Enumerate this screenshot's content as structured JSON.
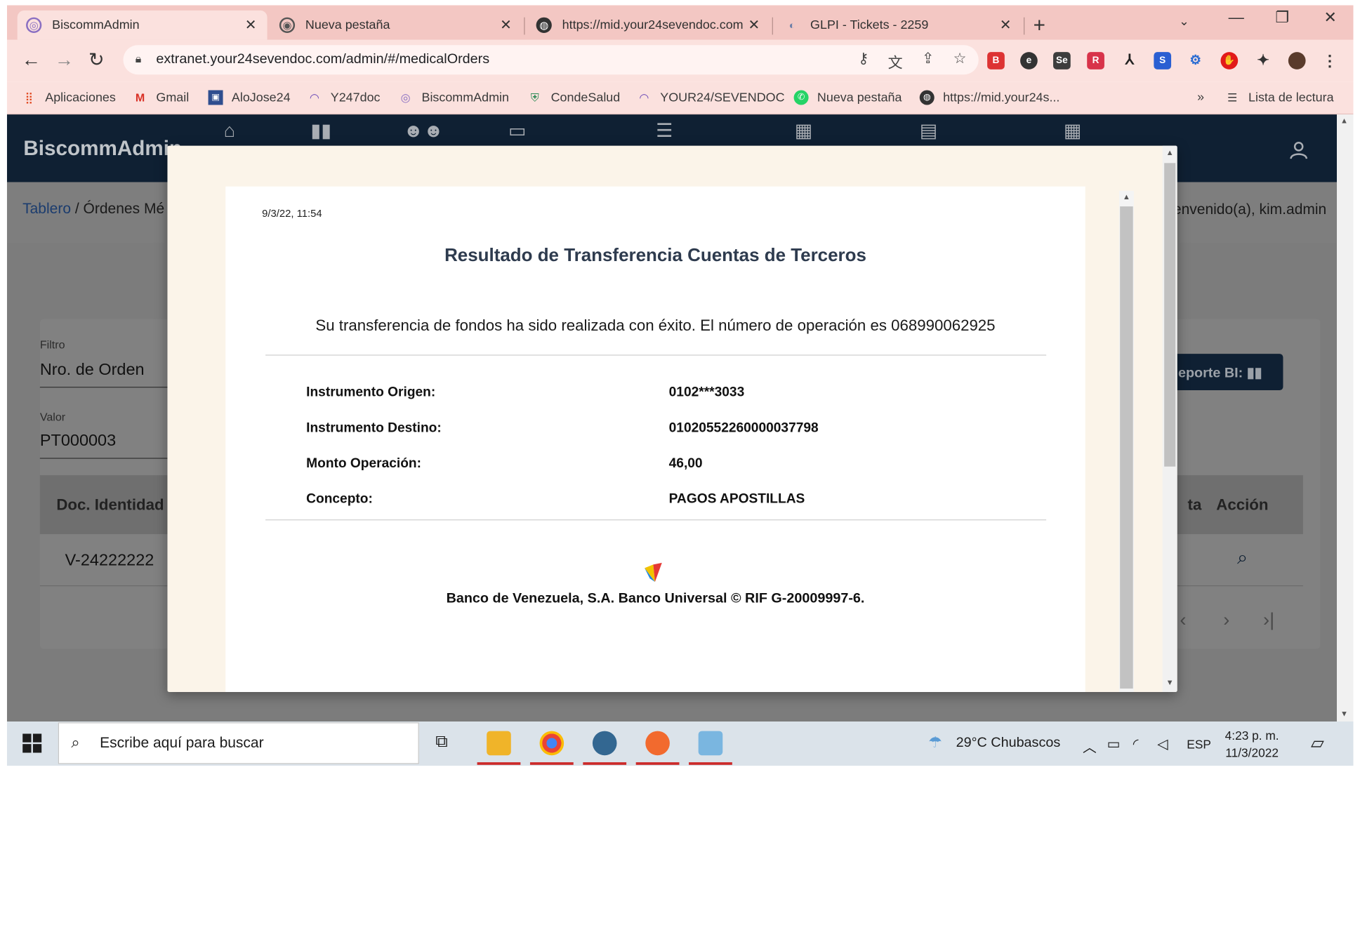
{
  "browser": {
    "tabs": [
      {
        "title": "BiscommAdmin",
        "active": true
      },
      {
        "title": "Nueva pestaña",
        "active": false
      },
      {
        "title": "https://mid.your24sevendoc.com",
        "active": false
      },
      {
        "title": "GLPI - Tickets - 2259",
        "active": false
      }
    ],
    "new_tab": "+",
    "url": "extranet.your24sevendoc.com/admin/#/medicalOrders",
    "bookmarks": [
      "Aplicaciones",
      "Gmail",
      "AloJose24",
      "Y247doc",
      "BiscommAdmin",
      "CondeSalud",
      "YOUR24/SEVENDOC",
      "Nueva pestaña",
      "https://mid.your24s..."
    ],
    "bookmarks_more": "»",
    "reading_list": "Lista de lectura"
  },
  "app": {
    "name": "BiscommAdmin",
    "breadcrumb_root": "Tablero",
    "breadcrumb_sep": " / ",
    "breadcrumb_current": "Órdenes Mé",
    "welcome": "envenido(a), kim.admin",
    "filter_label": "Filtro",
    "filter_value": "Nro. de Orden",
    "value_label": "Valor",
    "value_value": "PT000003",
    "report_button": "eporte BI:",
    "table": {
      "col_doc": "Doc. Identidad",
      "col_partial": "ta",
      "col_action": "Acción",
      "row_doc": "V-24222222"
    }
  },
  "receipt": {
    "timestamp": "9/3/22, 11:54",
    "title": "Resultado de Transferencia Cuentas de Terceros",
    "message": "Su transferencia de fondos ha sido realizada con éxito. El número de operación es 068990062925",
    "fields": [
      {
        "label": "Instrumento Origen:",
        "value": "0102***3033"
      },
      {
        "label": "Instrumento Destino:",
        "value": "01020552260000037798"
      },
      {
        "label": "Monto Operación:",
        "value": "46,00"
      },
      {
        "label": "Concepto:",
        "value": "PAGOS APOSTILLAS"
      }
    ],
    "footer": "Banco de Venezuela, S.A. Banco Universal © RIF G-20009997-6."
  },
  "taskbar": {
    "search_placeholder": "Escribe aquí para buscar",
    "weather": "29°C  Chubascos",
    "language": "ESP",
    "time": "4:23 p. m.",
    "date": "11/3/2022"
  }
}
